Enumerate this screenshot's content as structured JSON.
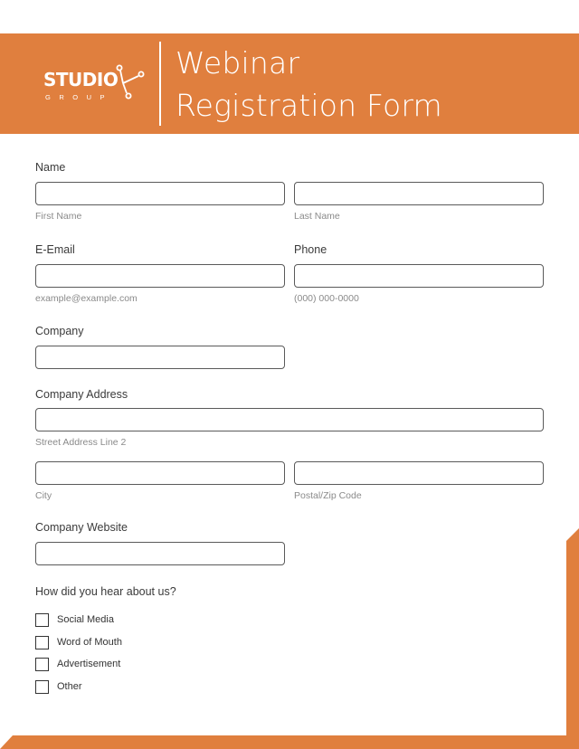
{
  "header": {
    "logo": {
      "name": "STUDIO",
      "sub": "GROUP",
      "icon": "network-nodes-icon"
    },
    "title_line1": "Webinar",
    "title_line2": "Registration Form",
    "accent_color": "#E07F3E"
  },
  "form": {
    "name": {
      "label": "Name",
      "first": {
        "value": "",
        "sublabel": "First Name"
      },
      "last": {
        "value": "",
        "sublabel": "Last Name"
      }
    },
    "email": {
      "label": "E-Email",
      "value": "",
      "sublabel": "example@example.com"
    },
    "phone": {
      "label": "Phone",
      "value": "",
      "sublabel": "(000) 000-0000"
    },
    "company": {
      "label": "Company",
      "value": ""
    },
    "address": {
      "label": "Company Address",
      "street": {
        "value": "",
        "sublabel": "Street Address Line 2"
      },
      "city": {
        "value": "",
        "sublabel": "City"
      },
      "zip": {
        "value": "",
        "sublabel": "Postal/Zip Code"
      }
    },
    "website": {
      "label": "Company Website",
      "value": ""
    },
    "hear_about": {
      "label": "How did you hear about us?",
      "options": [
        {
          "label": "Social Media",
          "checked": false
        },
        {
          "label": "Word of Mouth",
          "checked": false
        },
        {
          "label": "Advertisement",
          "checked": false
        },
        {
          "label": "Other",
          "checked": false
        }
      ]
    }
  }
}
